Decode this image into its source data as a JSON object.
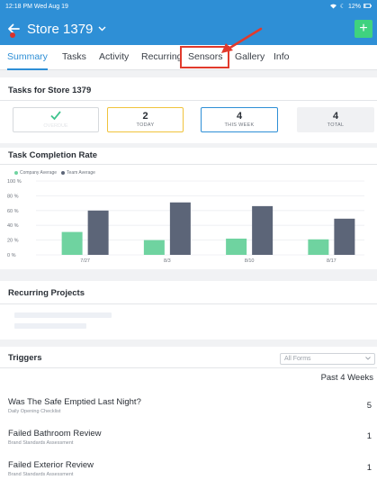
{
  "status_bar": {
    "time": "12:18 PM  Wed Aug 19",
    "wifi_icon": "wifi-icon",
    "battery_icon": "battery-icon",
    "battery": "12%"
  },
  "nav": {
    "title": "Store 1379",
    "back_icon": "back-arrow-icon",
    "chevron_icon": "chevron-down-icon",
    "add_label": "+"
  },
  "tabs": [
    {
      "label": "Summary",
      "active": true
    },
    {
      "label": "Tasks"
    },
    {
      "label": "Activity"
    },
    {
      "label": "Recurring"
    },
    {
      "label": "Sensors"
    },
    {
      "label": "Gallery"
    },
    {
      "label": "Info"
    }
  ],
  "tasks_section": {
    "title": "Tasks for Store 1379",
    "stats": [
      {
        "label": "",
        "icon": "checkmark-icon",
        "faint_label": "OVERDUE"
      },
      {
        "value": "2",
        "label": "TODAY"
      },
      {
        "value": "4",
        "label": "THIS WEEK"
      },
      {
        "value": "4",
        "label": "TOTAL"
      }
    ]
  },
  "completion_section": {
    "title": "Task Completion Rate",
    "legend": [
      "Company Average",
      "Team Average"
    ]
  },
  "chart_data": {
    "type": "bar",
    "categories": [
      "7/27",
      "8/3",
      "8/10",
      "8/17"
    ],
    "series": [
      {
        "name": "Company Average",
        "values": [
          31,
          20,
          22,
          21
        ],
        "color": "#6fd3a0"
      },
      {
        "name": "Team Average",
        "values": [
          60,
          71,
          66,
          49
        ],
        "color": "#5c6578"
      }
    ],
    "ylim": [
      0,
      100
    ],
    "yticks": [
      "0 %",
      "20 %",
      "40 %",
      "60 %",
      "80 %",
      "100 %"
    ],
    "legend_position": "top-left",
    "grid": true
  },
  "recurring_section": {
    "title": "Recurring Projects"
  },
  "triggers_section": {
    "title": "Triggers",
    "select_value": "All Forms",
    "period": "Past 4 Weeks",
    "items": [
      {
        "title": "Was The Safe Emptied Last Night?",
        "subtitle": "Daily Opening Checklist",
        "count": "5"
      },
      {
        "title": "Failed Bathroom Review",
        "subtitle": "Brand Standards Assessment",
        "count": "1"
      },
      {
        "title": "Failed Exterior Review",
        "subtitle": "Brand Standards Assessment",
        "count": "1"
      }
    ]
  },
  "colors": {
    "header": "#2e8fd6",
    "add_button": "#3fd27f",
    "today_border": "#f0c33c",
    "week_border": "#2e8fd6",
    "highlight": "#e13a2c"
  }
}
